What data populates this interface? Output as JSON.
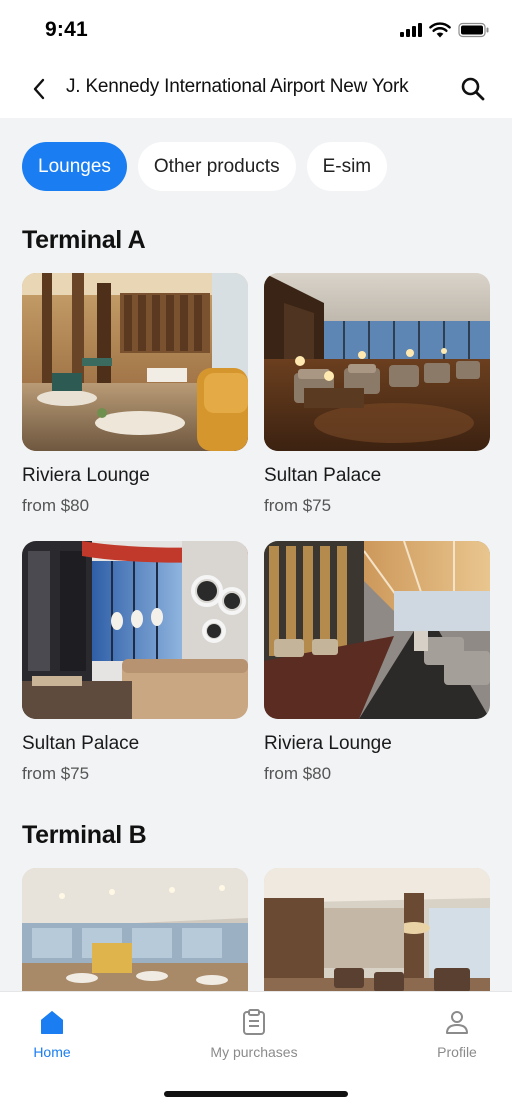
{
  "status_bar": {
    "time": "9:41"
  },
  "header": {
    "title": "J. Kennedy International Airport New York"
  },
  "tabs": [
    {
      "label": "Lounges",
      "active": true
    },
    {
      "label": "Other products",
      "active": false
    },
    {
      "label": "E-sim",
      "active": false
    }
  ],
  "sections": [
    {
      "title": "Terminal A",
      "cards": [
        {
          "name": "Riviera Lounge",
          "price": "from $80"
        },
        {
          "name": "Sultan Palace",
          "price": "from $75"
        },
        {
          "name": "Sultan Palace",
          "price": "from $75"
        },
        {
          "name": "Riviera Lounge",
          "price": "from $80"
        }
      ]
    },
    {
      "title": "Terminal B",
      "cards": []
    }
  ],
  "bottom_nav": [
    {
      "label": "Home",
      "icon": "home-icon",
      "active": true
    },
    {
      "label": "My purchases",
      "icon": "clipboard-icon",
      "active": false
    },
    {
      "label": "Profile",
      "icon": "person-icon",
      "active": false
    }
  ],
  "colors": {
    "accent": "#1a7ef2",
    "background": "#f2f3f5"
  }
}
